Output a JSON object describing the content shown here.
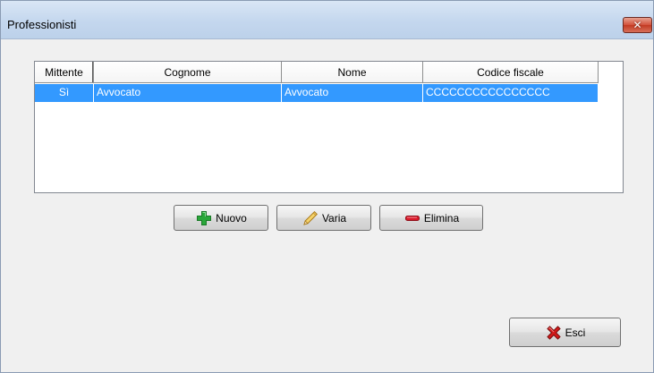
{
  "window": {
    "title": "Professionisti",
    "close_label": "✕"
  },
  "grid": {
    "columns": [
      "Mittente",
      "Cognome",
      "Nome",
      "Codice fiscale"
    ],
    "rows": [
      {
        "mittente": "Sì",
        "cognome": "Avvocato",
        "nome": "Avvocato",
        "codice_fiscale": "CCCCCCCCCCCCCCCC",
        "selected": true
      }
    ]
  },
  "buttons": {
    "nuovo": {
      "label": "Nuovo",
      "icon": "plus-icon"
    },
    "varia": {
      "label": "Varia",
      "icon": "pencil-icon"
    },
    "elimina": {
      "label": "Elimina",
      "icon": "minus-icon"
    },
    "esci": {
      "label": "Esci",
      "icon": "red-x-icon"
    }
  },
  "colors": {
    "selection": "#3399ff",
    "plus": "#2aa63a",
    "minus": "#d8192a",
    "x": "#d21a1a"
  }
}
